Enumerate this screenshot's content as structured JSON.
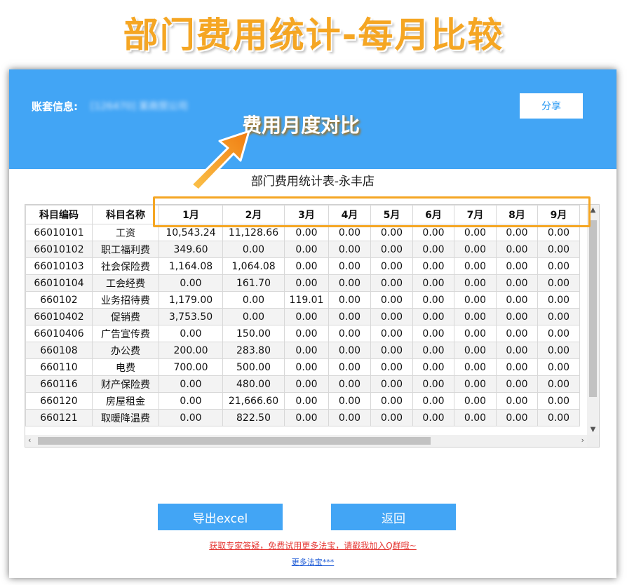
{
  "headline": "部门费用统计-每月比较",
  "banner": {
    "account_label": "账套信息:",
    "account_value": "[126470] 某商贸公司",
    "share_label": "分享",
    "callout": "费用月度对比"
  },
  "report": {
    "title": "部门费用统计表-永丰店",
    "columns": [
      "科目编码",
      "科目名称",
      "1月",
      "2月",
      "3月",
      "4月",
      "5月",
      "6月",
      "7月",
      "8月",
      "9月"
    ],
    "rows": [
      [
        "66010101",
        "工资",
        "10,543.24",
        "11,128.66",
        "0.00",
        "0.00",
        "0.00",
        "0.00",
        "0.00",
        "0.00",
        "0.00"
      ],
      [
        "66010102",
        "职工福利费",
        "349.60",
        "0.00",
        "0.00",
        "0.00",
        "0.00",
        "0.00",
        "0.00",
        "0.00",
        "0.00"
      ],
      [
        "66010103",
        "社会保险费",
        "1,164.08",
        "1,064.08",
        "0.00",
        "0.00",
        "0.00",
        "0.00",
        "0.00",
        "0.00",
        "0.00"
      ],
      [
        "66010104",
        "工会经费",
        "0.00",
        "161.70",
        "0.00",
        "0.00",
        "0.00",
        "0.00",
        "0.00",
        "0.00",
        "0.00"
      ],
      [
        "660102",
        "业务招待费",
        "1,179.00",
        "0.00",
        "119.01",
        "0.00",
        "0.00",
        "0.00",
        "0.00",
        "0.00",
        "0.00"
      ],
      [
        "66010402",
        "促销费",
        "3,753.50",
        "0.00",
        "0.00",
        "0.00",
        "0.00",
        "0.00",
        "0.00",
        "0.00",
        "0.00"
      ],
      [
        "66010406",
        "广告宣传费",
        "0.00",
        "150.00",
        "0.00",
        "0.00",
        "0.00",
        "0.00",
        "0.00",
        "0.00",
        "0.00"
      ],
      [
        "660108",
        "办公费",
        "200.00",
        "283.80",
        "0.00",
        "0.00",
        "0.00",
        "0.00",
        "0.00",
        "0.00",
        "0.00"
      ],
      [
        "660110",
        "电费",
        "700.00",
        "500.00",
        "0.00",
        "0.00",
        "0.00",
        "0.00",
        "0.00",
        "0.00",
        "0.00"
      ],
      [
        "660116",
        "财产保险费",
        "0.00",
        "480.00",
        "0.00",
        "0.00",
        "0.00",
        "0.00",
        "0.00",
        "0.00",
        "0.00"
      ],
      [
        "660120",
        "房屋租金",
        "0.00",
        "21,666.60",
        "0.00",
        "0.00",
        "0.00",
        "0.00",
        "0.00",
        "0.00",
        "0.00"
      ],
      [
        "660121",
        "取暖降温费",
        "0.00",
        "822.50",
        "0.00",
        "0.00",
        "0.00",
        "0.00",
        "0.00",
        "0.00",
        "0.00"
      ]
    ]
  },
  "actions": {
    "export_label": "导出excel",
    "back_label": "返回"
  },
  "links": {
    "promo": "获取专家答疑，免费试用更多法宝，请戳我加入Q群哦~",
    "more": "更多法宝***"
  },
  "colors": {
    "banner": "#42a5f5",
    "accent_orange": "#f5a623",
    "link_red": "#e53935",
    "link_blue": "#1e5bd6"
  }
}
